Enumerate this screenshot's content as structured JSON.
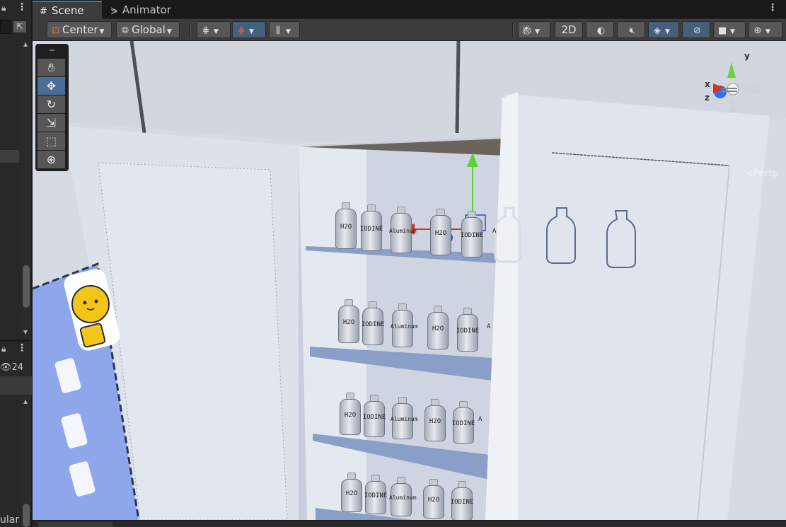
{
  "tabs": [
    {
      "label": "Scene",
      "icon": "grid-icon",
      "active": true
    },
    {
      "label": "Animator",
      "icon": "animator-icon",
      "active": false
    }
  ],
  "toolbar": {
    "pivot_label": "Center",
    "space_label": "Global",
    "mode_2d_label": "2D"
  },
  "left_panel": {
    "visible_count": "24",
    "partial_label": "ular"
  },
  "scene_view": {
    "projection_label": "Persp",
    "axes": {
      "x": "x",
      "y": "y",
      "z": "z"
    }
  },
  "shelf_labels": {
    "h2o": "H2O",
    "iodine": "IODINE",
    "aluminum": "Aluminum",
    "partial": "A"
  },
  "colors": {
    "accent_tab": "#3a79bb",
    "active_tool": "#4a6d96",
    "sky": "#d5dae3",
    "cabinet": "#dfe4ed",
    "shelf": "#8a9fc8",
    "card": "#8ea7ea"
  }
}
